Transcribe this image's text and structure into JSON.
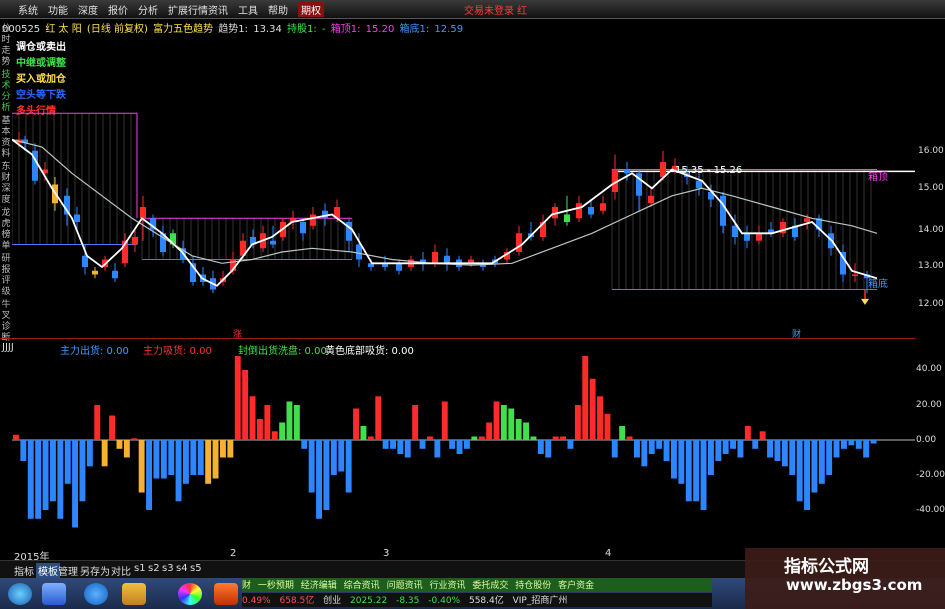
{
  "menu": {
    "items": [
      "系统",
      "功能",
      "深度",
      "报价",
      "分析",
      "扩展行情",
      "资讯",
      "工具",
      "帮助"
    ],
    "active": "期权",
    "right": "交易未登录  红"
  },
  "sidebar": [
    "分时走势",
    "技术分析",
    "基本资料",
    "东财深度",
    "龙虎榜单",
    "研报评级",
    "牛叉诊断"
  ],
  "stock": {
    "code": "000525",
    "name": "红 太 阳",
    "period": "(日线 前复权)",
    "indicator": "富力五色趋势",
    "trend_label": "趋势1:",
    "trend": "13.34",
    "hold_label": "持股1:",
    "hold": "-",
    "box_top_label": "箱顶1:",
    "box_top": "15.20",
    "box_bottom_label": "箱底1:",
    "box_bottom": "12.59"
  },
  "legend": [
    {
      "label": "调仓或卖出",
      "color": "#ffffff"
    },
    {
      "label": "中继或调整",
      "color": "#3fe04a"
    },
    {
      "label": "买入或加仓",
      "color": "#ffe14a"
    },
    {
      "label": "空头等下跌",
      "color": "#2e66ff"
    },
    {
      "label": "多头行情",
      "color": "#ff3030"
    }
  ],
  "annotations": {
    "range": "15.35 - 15.26",
    "box_top": "箱顶",
    "box_bottom": "箱底",
    "zhang": "涨",
    "cai": "财"
  },
  "price_axis": [
    16.0,
    15.0,
    14.0,
    13.0,
    12.0
  ],
  "indicator_panel": {
    "name": "JJJJ",
    "fields": [
      {
        "label": "主力出货: 0.00",
        "color": "#3c9bff"
      },
      {
        "label": "主力吸货: 0.00",
        "color": "#ff3030"
      },
      {
        "label": "封倒出货洗盘: 0.00",
        "color": "#3fe04a"
      },
      {
        "label": "黄色底部吸货: 0.00",
        "color": "#ffffff"
      }
    ],
    "axis": [
      40.0,
      20.0,
      0.0,
      -20.0,
      -40.0
    ]
  },
  "timeaxis": [
    "2015年",
    "2",
    "3",
    "4"
  ],
  "bottom_tabs": [
    "指标",
    "模板",
    "管理",
    "另存为",
    "对比",
    "s1",
    "s2",
    "s3",
    "s4",
    "s5"
  ],
  "selected_tab": "模板",
  "ticker": [
    "0.49%",
    "658.5亿",
    "创业",
    "2025.22",
    "-8.35",
    "-0.40%",
    "558.4亿",
    "VIP_招商广州"
  ],
  "ticker_news": [
    "财",
    "一秒预期",
    "经济编辑",
    "综合资讯",
    "问题资讯",
    "行业资讯",
    "委托成交",
    "持仓股份",
    "客户资金"
  ],
  "watermark": {
    "line1": "指标公式网",
    "line2": "www.zbgs3.com"
  },
  "colors": {
    "up": "#ff2a2a",
    "down": "#2e86ff",
    "mid": "#3fe04a",
    "buy": "#f4b230",
    "ma": "#e8e8e8"
  },
  "chart_data": {
    "type": "bar",
    "x": [
      "2015年",
      "2",
      "3",
      "4"
    ],
    "values": [
      3,
      -12,
      -45,
      -45,
      -40,
      -35,
      -45,
      -25,
      -50,
      -35,
      -15,
      20,
      -15,
      14,
      -5,
      -10,
      1,
      -30,
      -40,
      -22,
      -22,
      -20,
      -35,
      -25,
      -20,
      -20,
      -25,
      -22,
      -10,
      -10,
      48,
      40,
      25,
      12,
      20,
      5,
      10,
      22,
      20,
      -5,
      -30,
      -45,
      -40,
      -20,
      -18,
      -30,
      18,
      8,
      2,
      25,
      -5,
      -5,
      -8,
      -10,
      20,
      -5,
      2,
      -10,
      22,
      -5,
      -8,
      -5,
      2,
      2,
      10,
      22,
      20,
      18,
      12,
      10,
      2,
      -8,
      -10,
      2,
      2,
      -5,
      20,
      48,
      35,
      25,
      15,
      -10,
      8,
      2,
      -10,
      -15,
      -8,
      -5,
      -12,
      -22,
      -25,
      -35,
      -35,
      -40,
      -20,
      -12,
      -8,
      -5,
      -10,
      8,
      -5,
      5,
      -10,
      -12,
      -15,
      -20,
      -35,
      -40,
      -30,
      -25,
      -20,
      -10,
      -5,
      -3,
      -5,
      -10,
      -2
    ]
  }
}
